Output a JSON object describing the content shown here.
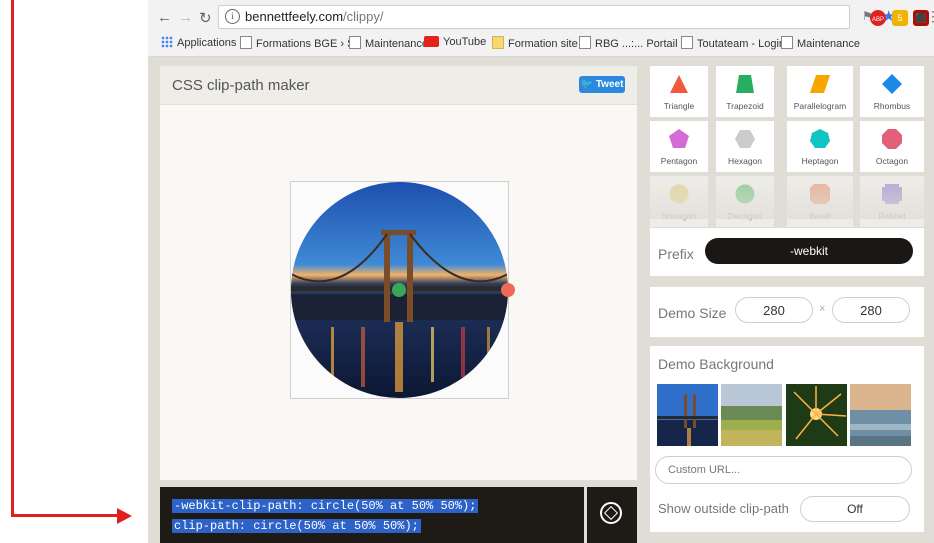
{
  "browser": {
    "url_host": "bennettfeely.com",
    "url_path": "/clippy/",
    "bookmarks": [
      {
        "label": "Applications",
        "icon": "apps-grid-icon"
      },
      {
        "label": "Formations BGE › Se",
        "icon": "page-icon"
      },
      {
        "label": "Maintenance",
        "icon": "page-icon"
      },
      {
        "label": "YouTube",
        "icon": "youtube-icon"
      },
      {
        "label": "Formation site",
        "icon": "folder-icon"
      },
      {
        "label": "RBG ...:... Portail",
        "icon": "page-icon"
      },
      {
        "label": "Toutateam - Login",
        "icon": "page-icon"
      },
      {
        "label": "Maintenance",
        "icon": "page-icon"
      }
    ],
    "ext_badges": [
      "ABP",
      "5"
    ]
  },
  "maker": {
    "title": "CSS clip-path maker",
    "tweet_label": "Tweet"
  },
  "code": {
    "line1": "-webkit-clip-path: circle(50% at 50% 50%);",
    "line2": "clip-path: circle(50% at 50% 50%);"
  },
  "shapes": [
    {
      "label": "Triangle",
      "color": "#f15a3a"
    },
    {
      "label": "Trapezoid",
      "color": "#27ae60"
    },
    {
      "label": "Parallelogram",
      "color": "#f7a600"
    },
    {
      "label": "Rhombus",
      "color": "#1e88e5"
    },
    {
      "label": "Pentagon",
      "color": "#d56bd4"
    },
    {
      "label": "Hexagon",
      "color": "#cccccc"
    },
    {
      "label": "Heptagon",
      "color": "#11c5c5"
    },
    {
      "label": "Octagon",
      "color": "#e2607a"
    },
    {
      "label": "Nonagon",
      "color": "#ead36c"
    },
    {
      "label": "Decagon",
      "color": "#3fbf5a"
    },
    {
      "label": "Bevel",
      "color": "#f2865c"
    },
    {
      "label": "Rabbet",
      "color": "#7b6bd8"
    }
  ],
  "settings": {
    "prefix_label": "Prefix",
    "prefix_value": "-webkit",
    "demo_size_label": "Demo Size",
    "width": "280",
    "height": "280",
    "times": "×",
    "demo_bg_label": "Demo Background",
    "custom_url_placeholder": "Custom URL...",
    "outside_label": "Show outside clip-path",
    "outside_value": "Off"
  }
}
